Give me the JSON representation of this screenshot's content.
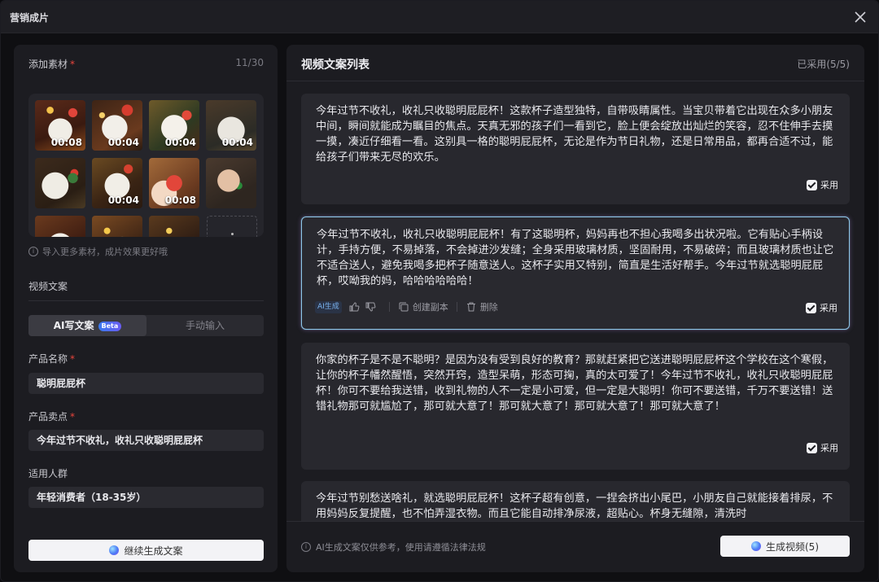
{
  "window": {
    "title": "营销成片"
  },
  "left": {
    "materials": {
      "label": "添加素材",
      "count": "11/30",
      "hint": "导入更多素材，成片效果更好哦"
    },
    "thumbnails": [
      {
        "duration": "00:08"
      },
      {
        "duration": "00:04"
      },
      {
        "duration": "00:04"
      },
      {
        "duration": "00:04"
      },
      {
        "duration": ""
      },
      {
        "duration": "00:04"
      },
      {
        "duration": "00:08"
      },
      {
        "duration": ""
      },
      {
        "duration": ""
      },
      {
        "duration": ""
      },
      {
        "duration": ""
      }
    ],
    "copy_section": "视频文案",
    "tabs": {
      "ai": "AI写文案",
      "beta": "Beta",
      "manual": "手动输入"
    },
    "product_name": {
      "label": "产品名称",
      "value": "聪明屁屁杯"
    },
    "selling_point": {
      "label": "产品卖点",
      "value": "今年过节不收礼，收礼只收聪明屁屁杯"
    },
    "audience": {
      "label": "适用人群",
      "value": "年轻消费者（18-35岁）"
    },
    "continue_button": "继续生成文案"
  },
  "right": {
    "title": "视频文案列表",
    "adopted_count": "已采用(5/5)",
    "adopt_label": "采用",
    "actions": {
      "ai_badge": "AI生成",
      "duplicate": "创建副本",
      "delete": "删除"
    },
    "cards": [
      {
        "text": "今年过节不收礼，收礼只收聪明屁屁杯！这款杯子造型独特，自带吸睛属性。当宝贝带着它出现在众多小朋友中间，瞬间就能成为瞩目的焦点。天真无邪的孩子们一看到它，脸上便会绽放出灿烂的笑容，忍不住伸手去摸一摸，凑近仔细看一看。这别具一格的聪明屁屁杯，无论是作为节日礼物，还是日常用品，都再合适不过，能给孩子们带来无尽的欢乐。"
      },
      {
        "text": "今年过节不收礼，收礼只收聪明屁屁杯！有了这聪明杯，妈妈再也不担心我喝多出状况啦。它有贴心手柄设计，手持方便，不易掉落，不会掉进沙发缝；全身采用玻璃材质，坚固耐用，不易破碎；而且玻璃材质也让它不适合送人，避免我喝多把杯子随意送人。这杯子实用又特别，简直是生活好帮手。今年过节就选聪明屁屁杯，哎呦我的妈，哈哈哈哈哈哈！"
      },
      {
        "text": "你家的杯子是不是不聪明？是因为没有受到良好的教育？那就赶紧把它送进聪明屁屁杯这个学校在这个寒假，让你的杯子幡然醒悟，突然开窍，造型呆萌，形态可掬，真的太可爱了！今年过节不收礼，收礼只收聪明屁屁杯！你可不要给我送错，收到礼物的人不一定是小可爱，但一定是大聪明！你可不要送错，千万不要送错！送错礼物那可就尴尬了，那可就大意了！那可就大意了！那可就大意了！那可就大意了！"
      },
      {
        "text": "今年过节别愁送啥礼，就选聪明屁屁杯！这杯子超有创意，一捏会挤出小尾巴，小朋友自己就能接着排尿，不用妈妈反复提醒，也不怕弄湿衣物。而且它能自动排净尿液，超贴心。杯身无缝隙，清洗时"
      }
    ],
    "disclaimer": "AI生成文案仅供参考，使用请遵循法律法规",
    "generate_button": "生成视频(5)"
  }
}
